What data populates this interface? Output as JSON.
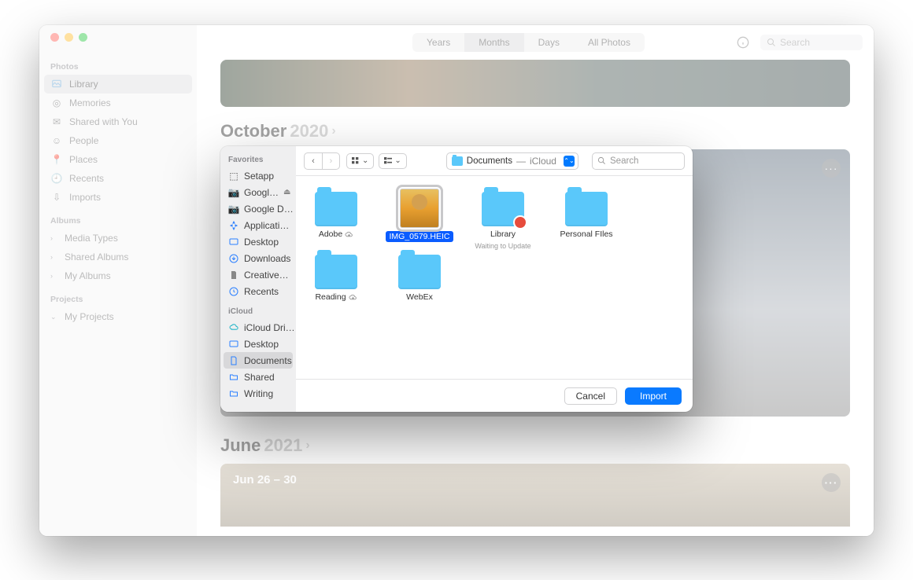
{
  "sidebar": {
    "sections": [
      {
        "title": "Photos",
        "items": [
          {
            "icon": "library",
            "label": "Library",
            "selected": true
          },
          {
            "icon": "memories",
            "label": "Memories"
          },
          {
            "icon": "shared",
            "label": "Shared with You"
          },
          {
            "icon": "people",
            "label": "People"
          },
          {
            "icon": "places",
            "label": "Places"
          },
          {
            "icon": "recents",
            "label": "Recents"
          },
          {
            "icon": "imports",
            "label": "Imports"
          }
        ]
      },
      {
        "title": "Albums",
        "items": [
          {
            "icon": "media",
            "label": "Media Types",
            "expand": ">"
          },
          {
            "icon": "shared-albums",
            "label": "Shared Albums",
            "expand": ">"
          },
          {
            "icon": "my-albums",
            "label": "My Albums",
            "expand": ">"
          }
        ]
      },
      {
        "title": "Projects",
        "items": [
          {
            "icon": "projects",
            "label": "My Projects",
            "expand": "v"
          }
        ]
      }
    ]
  },
  "toolbar": {
    "segments": [
      "Years",
      "Months",
      "Days",
      "All Photos"
    ],
    "segment_selected": 1,
    "search_placeholder": "Search"
  },
  "timeline": [
    {
      "month": "October",
      "year": "2020"
    },
    {
      "month": "June",
      "year": "2021",
      "caption": "Jun 26 – 30"
    }
  ],
  "finder": {
    "sidebar": {
      "sections": [
        {
          "title": "Favorites",
          "items": [
            {
              "icon": "setapp",
              "label": "Setapp"
            },
            {
              "icon": "camera",
              "label": "Googl…",
              "eject": true
            },
            {
              "icon": "camera",
              "label": "Google D…"
            },
            {
              "icon": "apps",
              "label": "Applicati…"
            },
            {
              "icon": "desktop",
              "label": "Desktop"
            },
            {
              "icon": "downloads",
              "label": "Downloads"
            },
            {
              "icon": "doc",
              "label": "Creative…"
            },
            {
              "icon": "recents",
              "label": "Recents"
            }
          ]
        },
        {
          "title": "iCloud",
          "items": [
            {
              "icon": "icloud",
              "label": "iCloud Dri…"
            },
            {
              "icon": "desktop",
              "label": "Desktop"
            },
            {
              "icon": "doc",
              "label": "Documents",
              "selected": true
            },
            {
              "icon": "folder",
              "label": "Shared"
            },
            {
              "icon": "folder",
              "label": "Writing"
            }
          ]
        }
      ]
    },
    "path": {
      "folder": "Documents",
      "location": "iCloud"
    },
    "search_placeholder": "Search",
    "items": [
      {
        "type": "folder",
        "name": "Adobe",
        "cloud": true
      },
      {
        "type": "file",
        "name": "IMG_0579.HEIC",
        "selected": true
      },
      {
        "type": "folder",
        "name": "Library",
        "badge": true,
        "subtitle": "Waiting to Update"
      },
      {
        "type": "folder",
        "name": "Personal FIles"
      },
      {
        "type": "folder",
        "name": "Reading",
        "cloud": true
      },
      {
        "type": "folder",
        "name": "WebEx"
      }
    ],
    "buttons": {
      "cancel": "Cancel",
      "import": "Import"
    }
  }
}
